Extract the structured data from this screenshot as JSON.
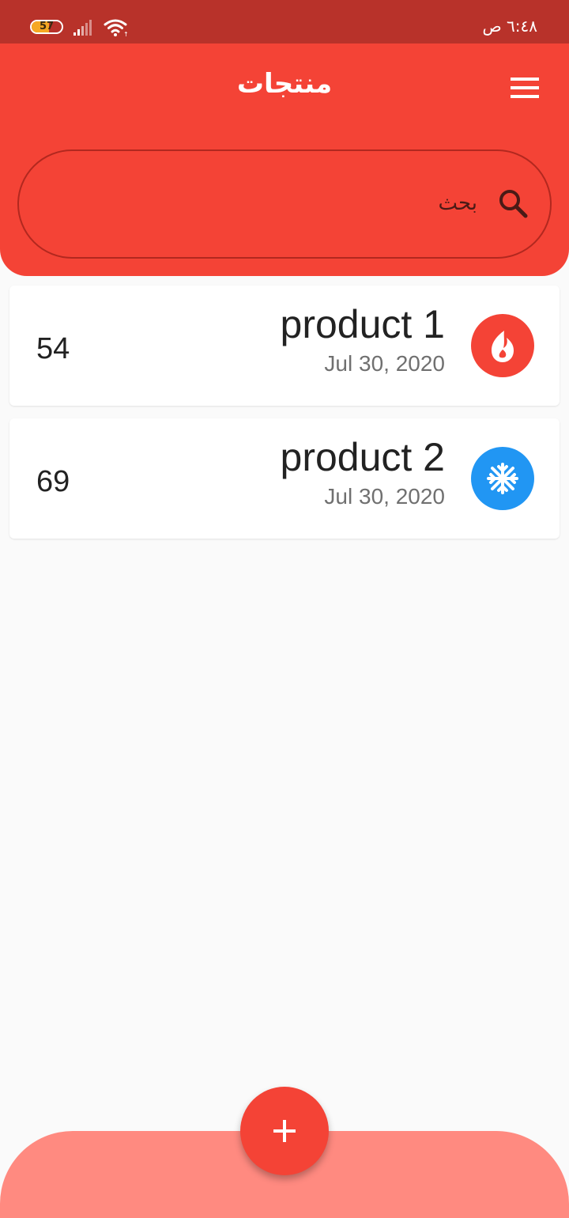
{
  "status_bar": {
    "time": "٦:٤٨ ص",
    "battery_level": "57",
    "battery_fraction": 0.57
  },
  "header": {
    "title": "منتجات",
    "search_placeholder": "بحث"
  },
  "products": [
    {
      "name": "product 1",
      "date": "Jul 30, 2020",
      "value": "54",
      "icon": "fire-icon",
      "color": "#f44336"
    },
    {
      "name": "product 2",
      "date": "Jul 30, 2020",
      "value": "69",
      "icon": "snowflake-icon",
      "color": "#2196f3"
    }
  ],
  "colors": {
    "status_bar": "#b8322a",
    "primary": "#f44336",
    "bottom_bar": "#ff8a80",
    "background": "#fafafa"
  }
}
